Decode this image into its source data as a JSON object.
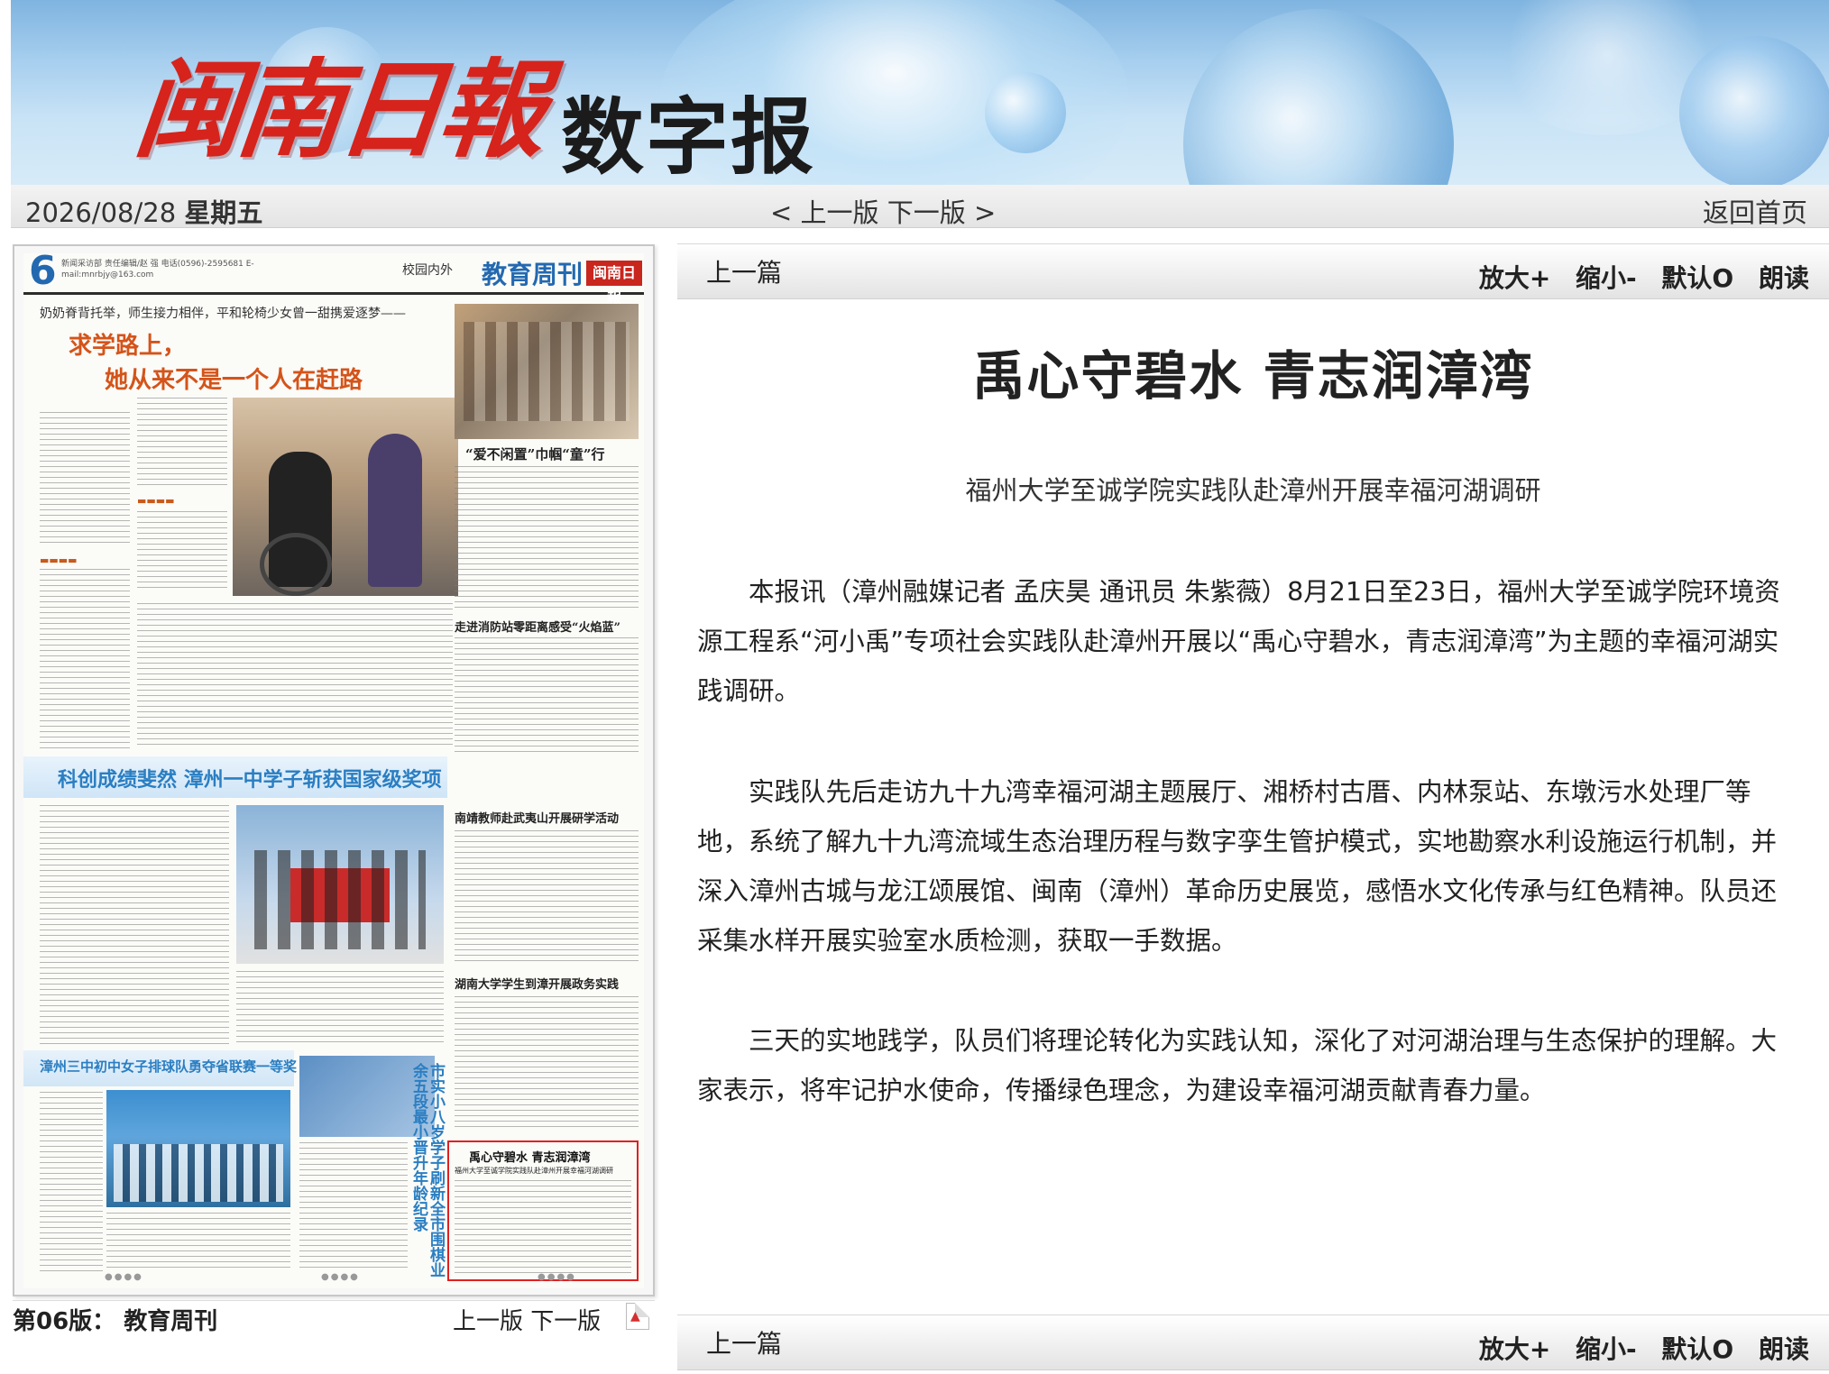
{
  "banner": {
    "logo_calligraphy": "闽南日報",
    "logo_text": "数字报"
  },
  "topnav": {
    "date": "2026/08/28",
    "weekday": "星期五",
    "prev_page": "< 上一版",
    "next_page": "下一版 >",
    "home": "返回首页"
  },
  "paper_thumbnail": {
    "page_number": "6",
    "section_title": "教育周刊",
    "section_sub": "校园内外",
    "logo": "闽南日報",
    "masthead_small": "新闻采访部 责任编辑/赵 强 电话(0596)-2595681 E-mail:mnrbjy@163.com",
    "story1_kicker": "奶奶脊背托举，师生接力相伴，平和轮椅少女曾一甜携爱逐梦——",
    "story1_headline_1": "求学路上，",
    "story1_headline_2": "她从来不是一个人在赶路",
    "story2_headline": "“爱不闲置”巾帼“童”行",
    "story3_headline": "走进消防站零距离感受“火焰蓝”",
    "story4_headline": "南靖教师赴武夷山开展研学活动",
    "story5_headline": "湖南大学学生到漳开展政务实践",
    "story6_headline": "科创成绩斐然 漳州一中学子斩获国家级奖项",
    "story7_headline": "漳州三中初中女子排球队勇夺省联赛一等奖",
    "story8_headline": "市实小八岁学子刷新全市围棋业余五段最小晋升年龄纪录",
    "highlight_title": "禹心守碧水 青志润漳湾",
    "highlight_sub": "福州大学至诚学院实践队赴漳州开展幸福河湖调研"
  },
  "paper_footer": {
    "edition": "第06版：  教育周刊",
    "prev": "上一版",
    "next": "下一版"
  },
  "article_toolbar": {
    "prev_article": "上一篇",
    "zoom_in": "放大+",
    "zoom_out": "缩小-",
    "default": "默认O",
    "read_aloud": "朗读"
  },
  "article": {
    "title": "禹心守碧水 青志润漳湾",
    "subtitle": "福州大学至诚学院实践队赴漳州开展幸福河湖调研",
    "paragraphs": [
      "本报讯（漳州融媒记者 孟庆昊 通讯员 朱紫薇）8月21日至23日，福州大学至诚学院环境资源工程系“河小禹”专项社会实践队赴漳州开展以“禹心守碧水，青志润漳湾”为主题的幸福河湖实践调研。",
      "实践队先后走访九十九湾幸福河湖主题展厅、湘桥村古厝、内林泵站、东墩污水处理厂等地，系统了解九十九湾流域生态治理历程与数字孪生管护模式，实地勘察水利设施运行机制，并深入漳州古城与龙江颂展馆、闽南（漳州）革命历史展览，感悟水文化传承与红色精神。队员还采集水样开展实验室水质检测，获取一手数据。",
      "三天的实地践学，队员们将理论转化为实践认知，深化了对河湖治理与生态保护的理解。大家表示，将牢记护水使命，传播绿色理念，为建设幸福河湖贡献青春力量。"
    ]
  },
  "colors": {
    "accent_red": "#d6231c",
    "section_blue": "#2369b0",
    "highlight_border": "#e02020"
  }
}
